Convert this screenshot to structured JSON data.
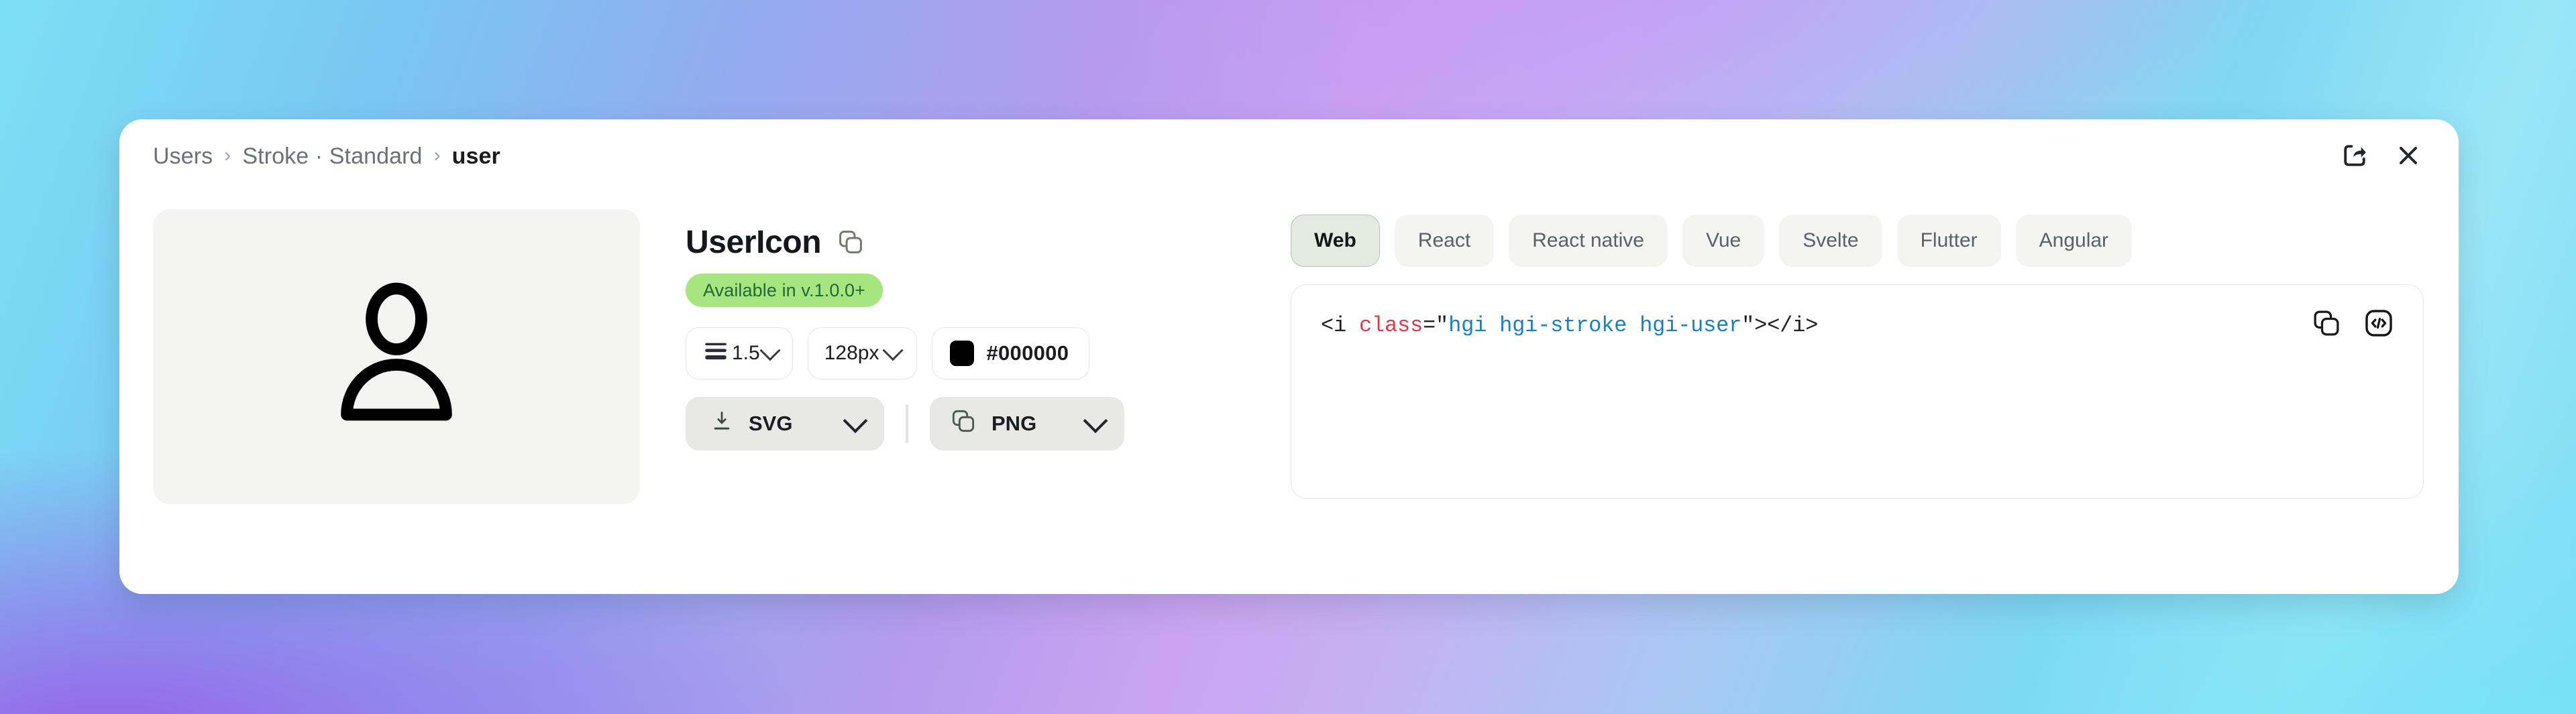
{
  "background": {
    "gradient_from": "#7ce0f5",
    "gradient_mid": "#b39bee",
    "gradient_to": "#7ddcf4",
    "accent_purple": "#9a5ce8"
  },
  "header": {
    "breadcrumb": [
      {
        "label": "Users",
        "current": false
      },
      {
        "label": "Stroke · Standard",
        "current": false
      },
      {
        "label": "user",
        "current": true
      }
    ],
    "separator": "›",
    "share_icon": "share-icon",
    "close_icon": "close-icon"
  },
  "preview": {
    "icon_name": "user-icon",
    "background": "#f4f4f3",
    "stroke_color": "#000000"
  },
  "details": {
    "title": "UserIcon",
    "copy_icon": "copy-icon",
    "badge": "Available in v.1.0.0+",
    "badge_bg": "#a6e57f",
    "badge_color": "#21693a"
  },
  "options": {
    "stroke": {
      "icon": "stroke-width-icon",
      "value": "1.5",
      "chevron": "chevron-down-icon"
    },
    "size": {
      "value": "128px",
      "chevron": "chevron-down-icon"
    },
    "color": {
      "swatch": "#000000",
      "value": "#000000"
    }
  },
  "downloads": {
    "svg": {
      "icon": "download-icon",
      "label": "SVG",
      "chevron": "chevron-down-icon"
    },
    "png": {
      "icon": "copy-icon",
      "label": "PNG",
      "chevron": "chevron-down-icon"
    }
  },
  "code": {
    "tabs": [
      {
        "label": "Web",
        "active": true
      },
      {
        "label": "React",
        "active": false
      },
      {
        "label": "React native",
        "active": false
      },
      {
        "label": "Vue",
        "active": false
      },
      {
        "label": "Svelte",
        "active": false
      },
      {
        "label": "Flutter",
        "active": false
      },
      {
        "label": "Angular",
        "active": false
      }
    ],
    "snippet": {
      "open_tag": "<i ",
      "attr": "class",
      "eq_quote": "=\"",
      "value": "hgi hgi-stroke hgi-user",
      "close_quote": "\">",
      "close_tag": "</i>"
    },
    "copy_icon": "copy-icon",
    "view_code_icon": "code-icon",
    "syntax_attr_color": "#d93c4a",
    "syntax_value_color": "#1a7fc1"
  }
}
